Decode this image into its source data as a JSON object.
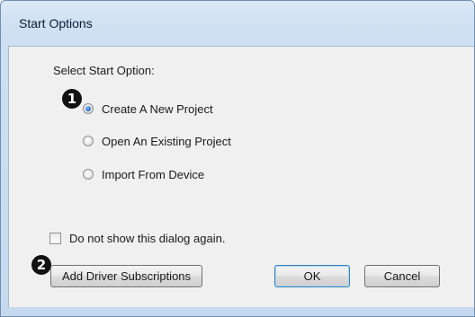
{
  "window": {
    "title": "Start Options"
  },
  "dialog": {
    "group_label": "Select Start Option:",
    "options": [
      {
        "label": "Create A New Project",
        "selected": true
      },
      {
        "label": "Open An Existing Project",
        "selected": false
      },
      {
        "label": "Import From Device",
        "selected": false
      }
    ],
    "dont_show_label": "Do not show this dialog again.",
    "dont_show_checked": false
  },
  "buttons": {
    "add_driver_label": "Add Driver Subscriptions",
    "ok_label": "OK",
    "cancel_label": "Cancel"
  },
  "callouts": {
    "first": "1",
    "second": "2"
  },
  "colors": {
    "accent": "#2a6fd6",
    "title_bar": "#dce9f7",
    "dialog_background": "#f0f0f0",
    "callout": "#111111"
  }
}
